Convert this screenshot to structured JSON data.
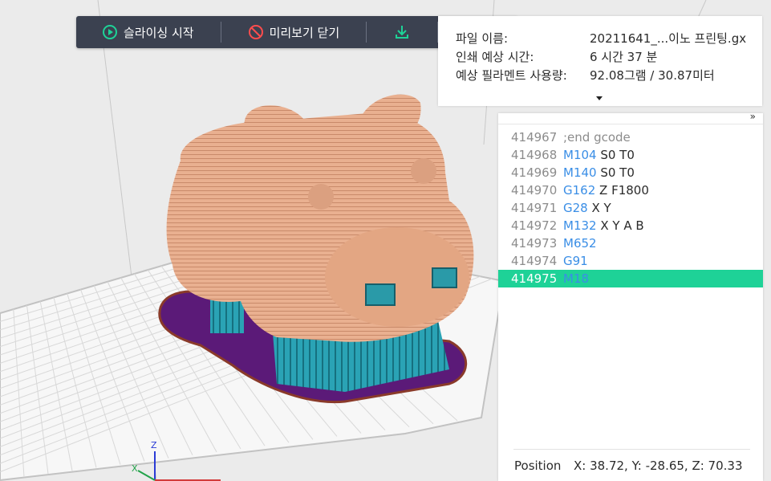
{
  "toolbar": {
    "start_slicing_label": "슬라이싱 시작",
    "close_preview_label": "미리보기 닫기",
    "download_icon": "download-icon",
    "print_icon": "print-icon"
  },
  "info": {
    "file_name_label": "파일 이름:",
    "file_name_value": "20211641_...이노 프린팅.gx",
    "print_time_label": "인쇄 예상 시간:",
    "print_time_value": "6 시간 37 분",
    "filament_label": "예상 필라멘트 사용량:",
    "filament_value": "92.08그램 / 30.87미터"
  },
  "gcode": {
    "expand_glyph": "»",
    "lines": [
      {
        "num": "414967",
        "cmd": "",
        "args": ";end gcode"
      },
      {
        "num": "414968",
        "cmd": "M104",
        "args": " S0 T0"
      },
      {
        "num": "414969",
        "cmd": "M140",
        "args": " S0 T0"
      },
      {
        "num": "414970",
        "cmd": "G162",
        "args": " Z F1800"
      },
      {
        "num": "414971",
        "cmd": "G28",
        "args": " X Y"
      },
      {
        "num": "414972",
        "cmd": "M132",
        "args": " X Y A B"
      },
      {
        "num": "414973",
        "cmd": "M652",
        "args": ""
      },
      {
        "num": "414974",
        "cmd": "G91",
        "args": ""
      },
      {
        "num": "414975",
        "cmd": "M18",
        "args": ""
      }
    ],
    "active_index": 8,
    "position_label": "Position",
    "position_value": "X: 38.72, Y: -28.65, Z: 70.33"
  },
  "axes": {
    "z_label": "Z",
    "x_label": "X"
  },
  "colors": {
    "toolbar_bg": "#3b4150",
    "accent_green": "#1ed297",
    "gcode_keyword": "#3a8ee6",
    "model_skin": "#e8ae8c",
    "support_teal": "#2aa3b5",
    "raft_purple": "#5b1a78"
  }
}
